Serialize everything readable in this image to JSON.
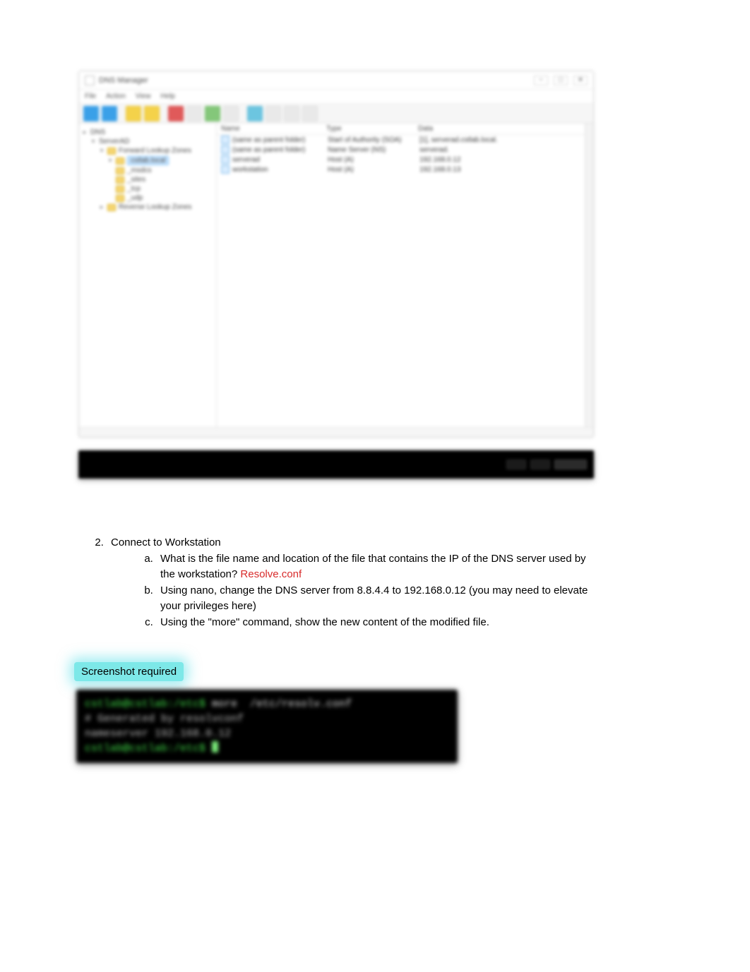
{
  "window": {
    "title": "DNS Manager",
    "menu": [
      "File",
      "Action",
      "View",
      "Help"
    ],
    "controls": {
      "min": "−",
      "max": "□",
      "close": "✕"
    },
    "tree": [
      {
        "label": "DNS",
        "level": 0,
        "expanded": true,
        "icon": "server"
      },
      {
        "label": "ServerAD",
        "level": 1,
        "expanded": true,
        "icon": "server"
      },
      {
        "label": "Forward Lookup Zones",
        "level": 2,
        "expanded": true,
        "icon": "folder"
      },
      {
        "label": "cstlab.local",
        "level": 3,
        "expanded": true,
        "icon": "folder",
        "selected": true
      },
      {
        "label": "_msdcs",
        "level": 4,
        "icon": "folder"
      },
      {
        "label": "_sites",
        "level": 4,
        "icon": "folder"
      },
      {
        "label": "_tcp",
        "level": 4,
        "icon": "folder"
      },
      {
        "label": "_udp",
        "level": 4,
        "icon": "folder"
      },
      {
        "label": "Reverse Lookup Zones",
        "level": 2,
        "icon": "folder"
      }
    ],
    "columns": {
      "name": "Name",
      "type": "Type",
      "data": "Data"
    },
    "rows": [
      {
        "name": "(same as parent folder)",
        "type": "Start of Authority (SOA)",
        "data": "[1], serverad.cstlab.local."
      },
      {
        "name": "(same as parent folder)",
        "type": "Name Server (NS)",
        "data": "serverad."
      },
      {
        "name": "serverad",
        "type": "Host (A)",
        "data": "192.168.0.12"
      },
      {
        "name": "workstation",
        "type": "Host (A)",
        "data": "192.168.0.13"
      }
    ]
  },
  "blackbar": {
    "right1": "",
    "right2": "",
    "right3": ""
  },
  "question": {
    "num_start": "2",
    "title": "Connect to Workstation",
    "a_text1": "What is the file name and location of the file that contains the IP of the DNS server used by the workstation? ",
    "a_answer": "Resolve.conf",
    "b_text": "Using nano, change the DNS server from 8.8.4.4 to 192.168.0.12 (you may need to elevate your privileges here)",
    "c_text": "Using the \"more\" command, show the new content of the modified file."
  },
  "highlight": "Screenshot required",
  "terminal": {
    "line1_prompt": "cstlab@cstlab:/etc$",
    "line1_cmd": " more  /etc/resolv.conf",
    "line2": "# Generated by resolvconf",
    "line3": "nameserver 192.168.0.12",
    "line4_prompt": "cstlab@cstlab:/etc$"
  }
}
